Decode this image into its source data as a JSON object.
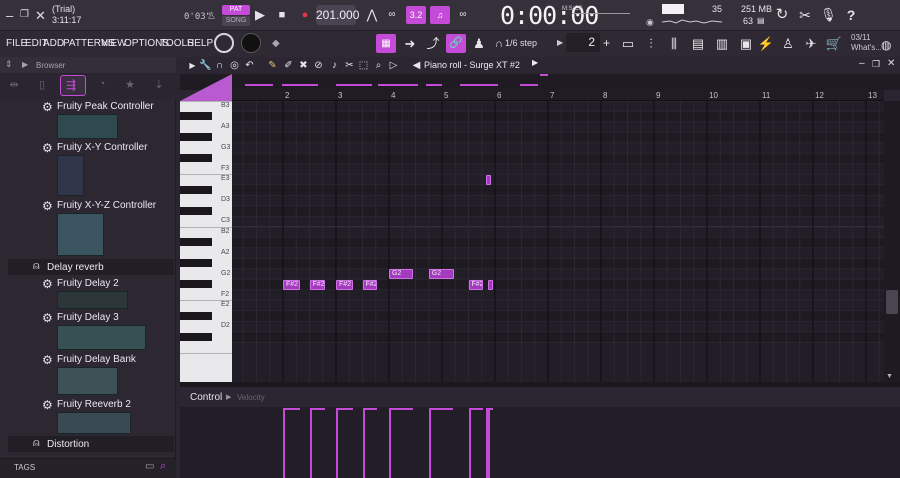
{
  "window": {
    "trial_label": "(Trial)",
    "song_time": "3:11:17",
    "counter": "0'03\"",
    "pat_label": "PAT",
    "song_label": "SONG",
    "tempo": "201.000",
    "time_display": "0:00:00",
    "time_mode": "M:S:CS",
    "cpu_value": "35",
    "memory": "251 MB",
    "polyphony": "63"
  },
  "menu": {
    "items": [
      "FILE",
      "EDIT",
      "ADD",
      "PATTERNS",
      "VIEW",
      "OPTIONS",
      "TOOLS",
      "HELP"
    ],
    "step_label": "1/6 step",
    "pattern_number": "2",
    "news_date": "03/11",
    "news_text": "What's..."
  },
  "browser": {
    "title": "Browser",
    "tags_label": "TAGS",
    "entries": [
      {
        "type": "plugin",
        "label": "Fruity Peak Controller"
      },
      {
        "type": "plugin",
        "label": "Fruity X-Y Controller"
      },
      {
        "type": "plugin",
        "label": "Fruity X-Y-Z Controller"
      },
      {
        "type": "folder",
        "label": "Delay reverb"
      },
      {
        "type": "plugin",
        "label": "Fruity Delay 2"
      },
      {
        "type": "plugin",
        "label": "Fruity Delay 3"
      },
      {
        "type": "plugin",
        "label": "Fruity Delay Bank"
      },
      {
        "type": "plugin",
        "label": "Fruity Reeverb 2"
      },
      {
        "type": "folder",
        "label": "Distortion"
      }
    ]
  },
  "piano_roll": {
    "title": "Piano roll - Surge XT #2",
    "bar_numbers": [
      "2",
      "3",
      "4",
      "5",
      "6",
      "7",
      "8",
      "9",
      "10",
      "11",
      "12",
      "13"
    ],
    "key_labels": [
      "B3",
      "A3",
      "G3",
      "F3",
      "E3",
      "D3",
      "C3",
      "B2",
      "A2",
      "G2",
      "F2",
      "E2",
      "D2"
    ],
    "notes": [
      {
        "pitch": "F#2",
        "label": "F#2",
        "start": 1.0,
        "length": 0.32
      },
      {
        "pitch": "F#2",
        "label": "F#2",
        "start": 1.5,
        "length": 0.3
      },
      {
        "pitch": "F#2",
        "label": "F#2",
        "start": 2.0,
        "length": 0.33
      },
      {
        "pitch": "F#2",
        "label": "F#2",
        "start": 2.5,
        "length": 0.28
      },
      {
        "pitch": "G2",
        "label": "G2",
        "start": 3.0,
        "length": 0.45
      },
      {
        "pitch": "G2",
        "label": "G2",
        "start": 3.75,
        "length": 0.47
      },
      {
        "pitch": "F#2",
        "label": "F#2",
        "start": 4.5,
        "length": 0.28
      },
      {
        "pitch": "F#2",
        "label": "",
        "start": 4.86,
        "length": 0.1
      },
      {
        "pitch": "E3",
        "label": "",
        "start": 4.83,
        "length": 0.1
      }
    ]
  },
  "control": {
    "label": "Control",
    "target": "Velocity"
  },
  "colors": {
    "accent": "#c44ad8",
    "note_fill": "#a33bbf",
    "background": "#221e27"
  }
}
